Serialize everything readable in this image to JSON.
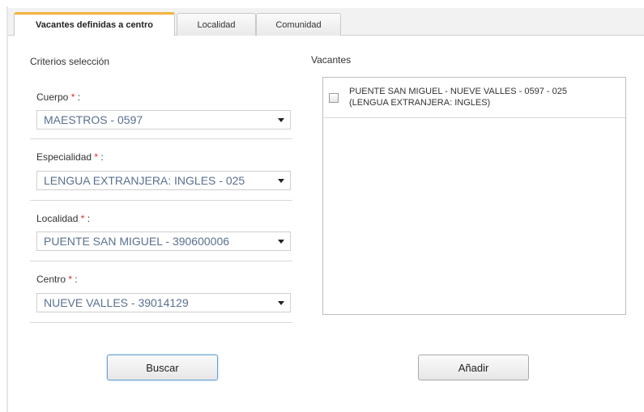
{
  "tabs": [
    {
      "label": "Vacantes definidas a centro",
      "active": true
    },
    {
      "label": "Localidad",
      "active": false
    },
    {
      "label": "Comunidad",
      "active": false
    }
  ],
  "criterios": {
    "title": "Criterios selección",
    "required_mark": "*",
    "fields": [
      {
        "label": "Cuerpo",
        "suffix": " :",
        "value": "MAESTROS - 0597"
      },
      {
        "label": "Especialidad",
        "suffix": " :",
        "value": "LENGUA EXTRANJERA: INGLES - 025"
      },
      {
        "label": "Localidad",
        "suffix": " :",
        "value": "PUENTE SAN MIGUEL - 390600006"
      },
      {
        "label": "Centro",
        "suffix": " :",
        "value": "NUEVE VALLES - 39014129"
      }
    ]
  },
  "vacantes": {
    "title": "Vacantes",
    "items": [
      {
        "line1": "PUENTE SAN MIGUEL - NUEVE VALLES - 0597 - 025",
        "line2": "(LENGUA EXTRANJERA: INGLES)",
        "checked": false
      }
    ]
  },
  "buttons": {
    "buscar": "Buscar",
    "anadir": "Añadir"
  },
  "colors": {
    "active_tab_accent": "#f2b43a",
    "required": "#e02a2a",
    "select_text": "#5a7090",
    "focus_border": "#6aa0d8"
  }
}
